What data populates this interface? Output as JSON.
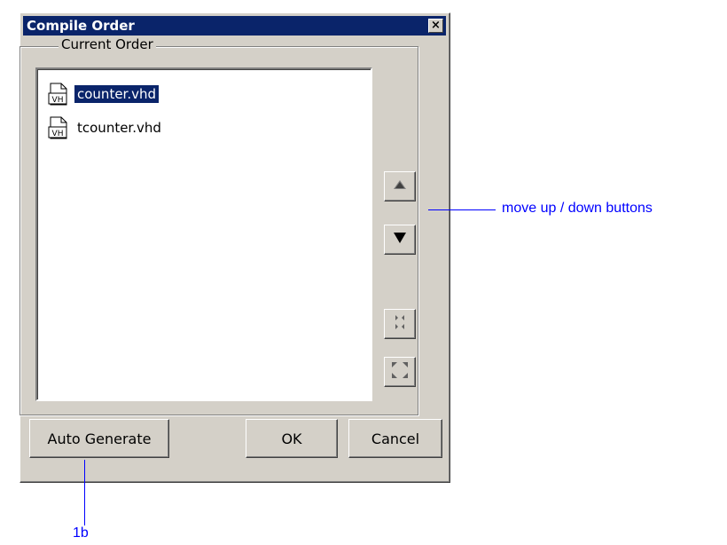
{
  "dialog": {
    "title": "Compile Order",
    "close_glyph": "×",
    "group_label": "Current Order",
    "files": [
      {
        "name": "counter.vhd",
        "selected": true,
        "icon": "vhdl-file-icon",
        "badge": "VH"
      },
      {
        "name": "tcounter.vhd",
        "selected": false,
        "icon": "vhdl-file-icon",
        "badge": "VH"
      }
    ],
    "side_buttons": [
      {
        "icon": "move-up-icon",
        "glyph": "▲"
      },
      {
        "icon": "move-down-icon",
        "glyph": "▼"
      },
      {
        "icon": "collapse-icon"
      },
      {
        "icon": "expand-icon"
      }
    ],
    "buttons": {
      "auto_generate": "Auto Generate",
      "ok": "OK",
      "cancel": "Cancel"
    }
  },
  "annotations": {
    "move_buttons": "move up / down buttons",
    "auto_generate": "1b"
  },
  "colors": {
    "title_bar": "#0a246a",
    "dialog_face": "#d4d0c8",
    "annotation": "#0000ff"
  }
}
